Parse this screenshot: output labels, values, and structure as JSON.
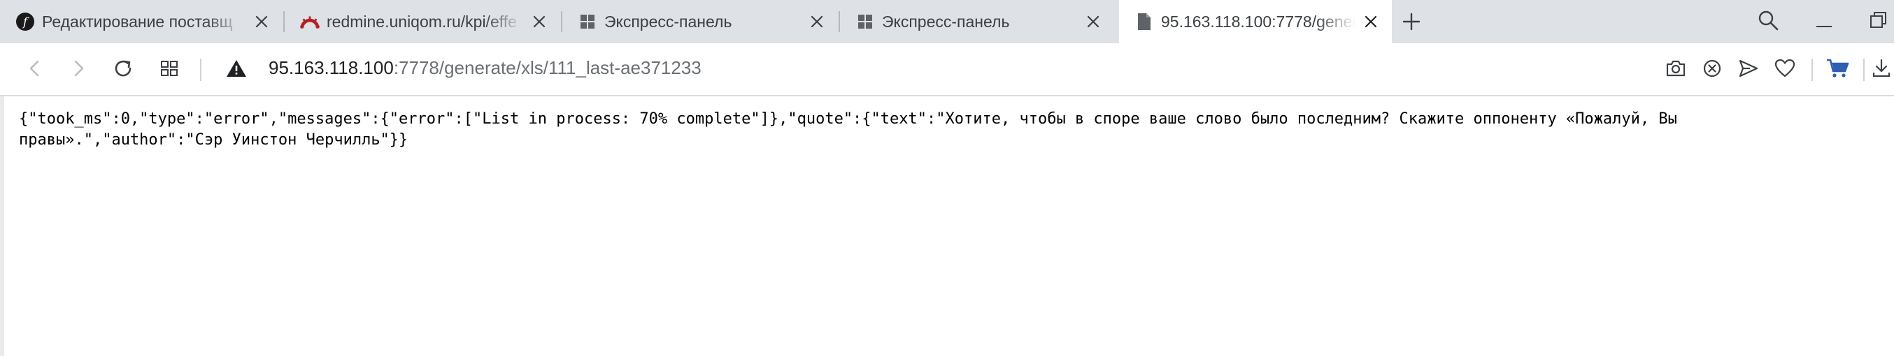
{
  "tabs": [
    {
      "title": "Редактирование поставщ",
      "icon": "symfony-icon",
      "active": false
    },
    {
      "title": "redmine.uniqom.ru/kpi/effe",
      "icon": "redmine-icon",
      "active": false
    },
    {
      "title": "Экспресс-панель",
      "icon": "speed-dial-icon",
      "active": false
    },
    {
      "title": "Экспресс-панель",
      "icon": "speed-dial-icon",
      "active": false
    },
    {
      "title": "95.163.118.100:7778/gener",
      "icon": "page-icon",
      "active": true
    }
  ],
  "address": {
    "host": "95.163.118.100",
    "rest": ":7778/generate/xls/111_last-ae371233",
    "security": "not-secure-warning-icon"
  },
  "colors": {
    "tab_strip": "#dee1e6",
    "active_tab": "#ffffff",
    "cart_accent": "#2f5fb3",
    "redmine_red": "#b32024"
  },
  "page": {
    "text": "{\"took_ms\":0,\"type\":\"error\",\"messages\":{\"error\":[\"List in process: 70% complete\"]},\"quote\":{\"text\":\"Хотите, чтобы в споре ваше слово было последним? Скажите оппоненту «Пожалуй, Вы правы».\",\"author\":\"Сэр Уинстон Черчилль\"}}"
  }
}
